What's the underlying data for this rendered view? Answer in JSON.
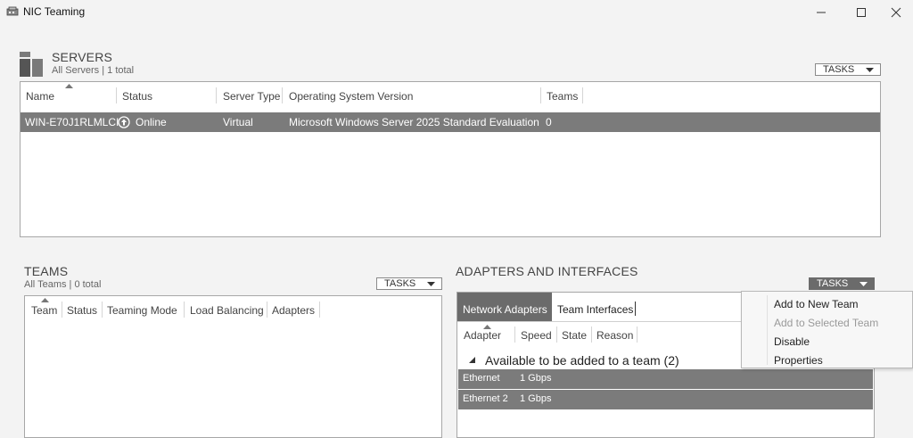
{
  "window": {
    "title": "NIC Teaming",
    "icon": "nic-teaming-app-icon",
    "controls": {
      "minimize": "minimize-icon",
      "maximize": "maximize-icon",
      "close": "close-icon"
    }
  },
  "servers": {
    "title": "SERVERS",
    "subtitle": "All Servers | 1 total",
    "tasks_label": "TASKS",
    "columns": [
      "Name",
      "Status",
      "Server Type",
      "Operating System Version",
      "Teams"
    ],
    "rows": [
      {
        "name": "WIN-E70J1RLMLCI",
        "status": "Online",
        "server_type": "Virtual",
        "os_version": "Microsoft Windows Server 2025 Standard Evaluation",
        "teams": "0"
      }
    ]
  },
  "teams": {
    "title": "TEAMS",
    "subtitle": "All Teams | 0 total",
    "tasks_label": "TASKS",
    "columns": [
      "Team",
      "Status",
      "Teaming Mode",
      "Load Balancing",
      "Adapters"
    ]
  },
  "adapters": {
    "title": "ADAPTERS AND INTERFACES",
    "tasks_label": "TASKS",
    "tabs": [
      "Network Adapters",
      "Team Interfaces"
    ],
    "columns": [
      "Adapter",
      "Speed",
      "State",
      "Reason"
    ],
    "group_label": "Available to be added to a team (2)",
    "rows": [
      {
        "adapter": "Ethernet",
        "speed": "1 Gbps"
      },
      {
        "adapter": "Ethernet 2",
        "speed": "1 Gbps"
      }
    ]
  },
  "context_menu": {
    "items": [
      {
        "label": "Add to New Team",
        "enabled": true
      },
      {
        "label": "Add to Selected Team",
        "enabled": false
      },
      {
        "label": "Disable",
        "enabled": true
      },
      {
        "label": "Properties",
        "enabled": true
      }
    ]
  },
  "colors": {
    "selection": "#7b7b7b",
    "tab_active": "#6b6b6b",
    "window_bg": "#f3f3f3"
  }
}
